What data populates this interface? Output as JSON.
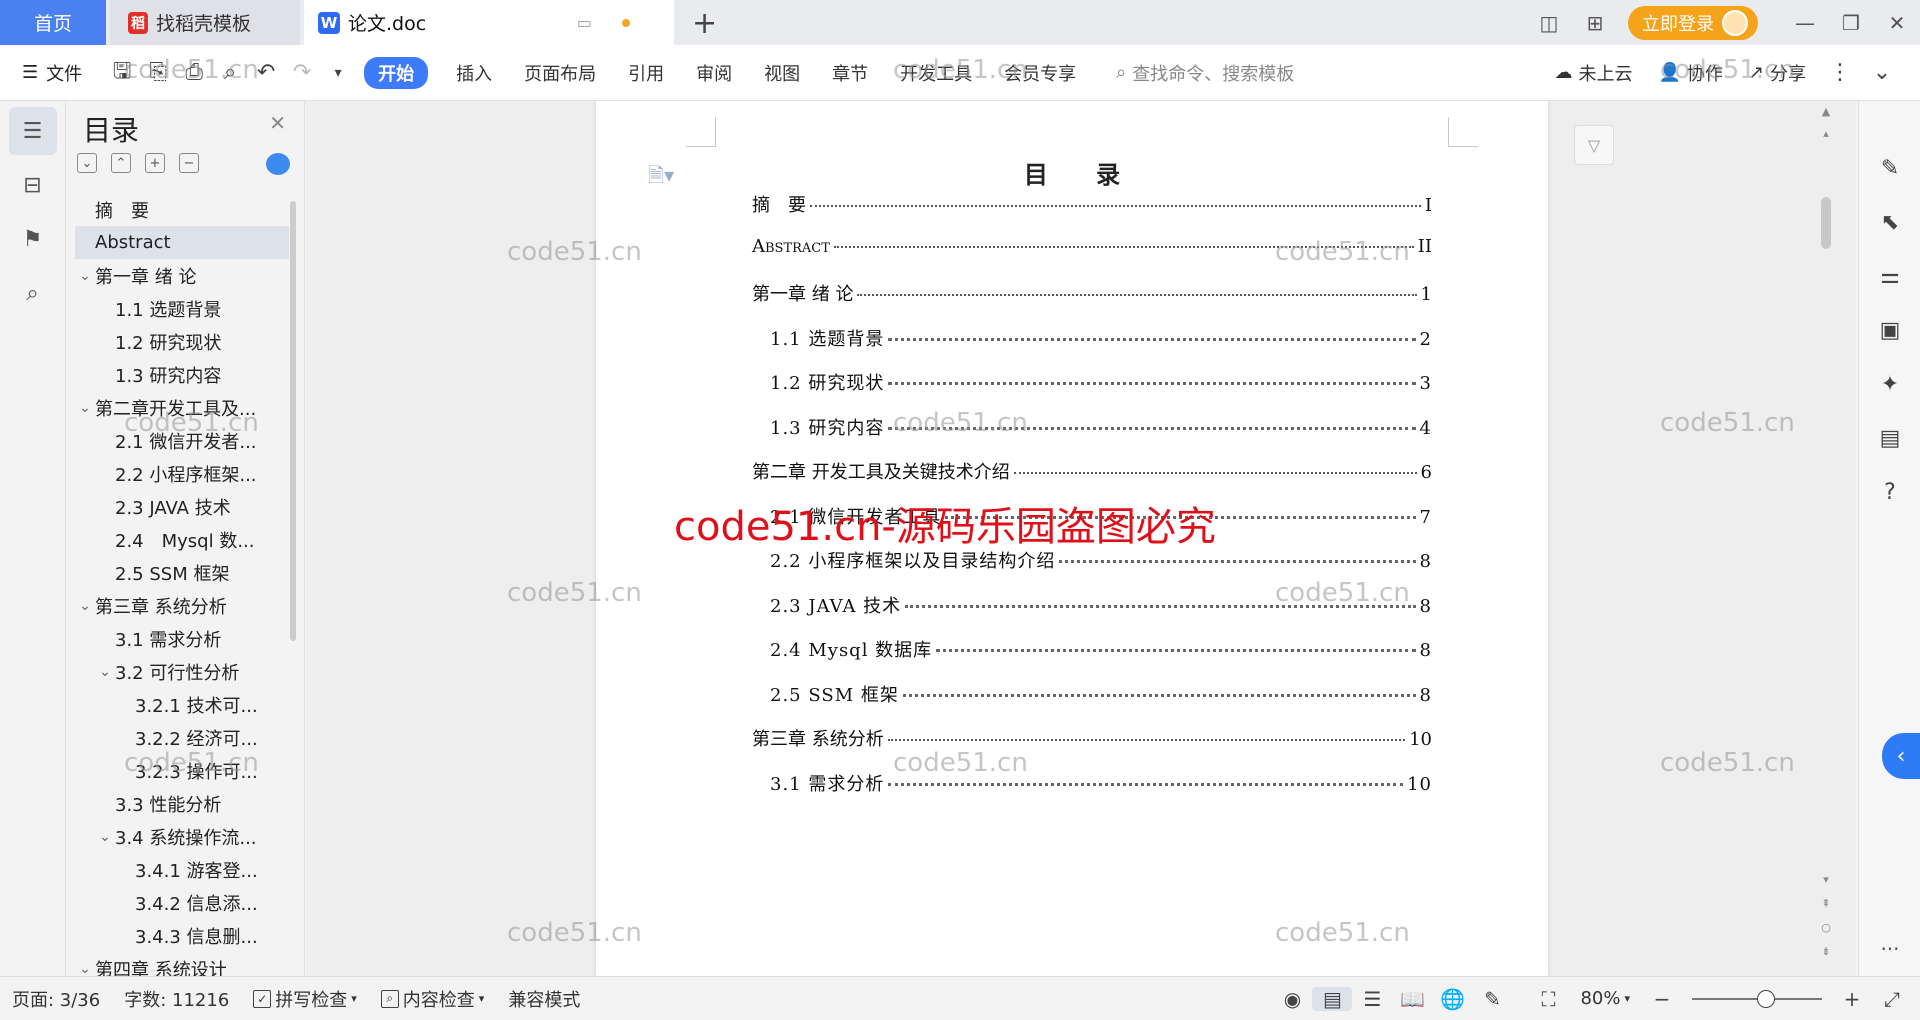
{
  "tabs": {
    "home": "首页",
    "template": "找稻壳模板",
    "document": "论文.doc",
    "new_tab": "+"
  },
  "titlebar": {
    "login": "立即登录"
  },
  "ribbon": {
    "file": "文件",
    "start": "开始",
    "menus": [
      "插入",
      "页面布局",
      "引用",
      "审阅",
      "视图",
      "章节",
      "开发工具",
      "会员专享"
    ],
    "search_placeholder": "查找命令、搜索模板",
    "cloud": "未上云",
    "collab": "协作",
    "share": "分享"
  },
  "toc_panel": {
    "title": "目录",
    "items": [
      {
        "label": "摘　要",
        "level": 0,
        "caret": "",
        "selected": false
      },
      {
        "label": "Abstract",
        "level": 0,
        "caret": "",
        "selected": true
      },
      {
        "label": "第一章 绪 论",
        "level": 0,
        "caret": "v",
        "selected": false
      },
      {
        "label": "1.1 选题背景",
        "level": 1,
        "caret": "",
        "selected": false
      },
      {
        "label": "1.2 研究现状",
        "level": 1,
        "caret": "",
        "selected": false
      },
      {
        "label": "1.3 研究内容",
        "level": 1,
        "caret": "",
        "selected": false
      },
      {
        "label": "第二章开发工具及...",
        "level": 0,
        "caret": "v",
        "selected": false
      },
      {
        "label": "2.1 微信开发者...",
        "level": 1,
        "caret": "",
        "selected": false
      },
      {
        "label": "2.2 小程序框架...",
        "level": 1,
        "caret": "",
        "selected": false
      },
      {
        "label": "2.3 JAVA 技术",
        "level": 1,
        "caret": "",
        "selected": false
      },
      {
        "label": "2.4　Mysql 数...",
        "level": 1,
        "caret": "",
        "selected": false
      },
      {
        "label": "2.5 SSM 框架",
        "level": 1,
        "caret": "",
        "selected": false
      },
      {
        "label": "第三章 系统分析",
        "level": 0,
        "caret": "v",
        "selected": false
      },
      {
        "label": "3.1 需求分析",
        "level": 1,
        "caret": "",
        "selected": false
      },
      {
        "label": "3.2 可行性分析",
        "level": 1,
        "caret": "v",
        "selected": false
      },
      {
        "label": "3.2.1 技术可...",
        "level": 2,
        "caret": "",
        "selected": false
      },
      {
        "label": "3.2.2 经济可...",
        "level": 2,
        "caret": "",
        "selected": false
      },
      {
        "label": "3.2.3 操作可...",
        "level": 2,
        "caret": "",
        "selected": false
      },
      {
        "label": "3.3 性能分析",
        "level": 1,
        "caret": "",
        "selected": false
      },
      {
        "label": "3.4 系统操作流...",
        "level": 1,
        "caret": "v",
        "selected": false
      },
      {
        "label": "3.4.1 游客登...",
        "level": 2,
        "caret": "",
        "selected": false
      },
      {
        "label": "3.4.2 信息添...",
        "level": 2,
        "caret": "",
        "selected": false
      },
      {
        "label": "3.4.3 信息删...",
        "level": 2,
        "caret": "",
        "selected": false
      },
      {
        "label": "第四章 系统设计",
        "level": 0,
        "caret": "v",
        "selected": false
      }
    ]
  },
  "document": {
    "title": "目 录",
    "entries": [
      {
        "label": "摘　要",
        "page": "I",
        "sub": false
      },
      {
        "label": "Abstract",
        "page": "II",
        "sub": false
      },
      {
        "label": "第一章 绪 论",
        "page": "1",
        "sub": false
      },
      {
        "label": "1.1 选题背景",
        "page": "2",
        "sub": true
      },
      {
        "label": "1.2 研究现状",
        "page": "3",
        "sub": true
      },
      {
        "label": "1.3 研究内容",
        "page": "4",
        "sub": true
      },
      {
        "label": "第二章 开发工具及关键技术介绍",
        "page": "6",
        "sub": false
      },
      {
        "label": "2.1 微信开发者工具",
        "page": "7",
        "sub": true
      },
      {
        "label": "2.2 小程序框架以及目录结构介绍",
        "page": "8",
        "sub": true
      },
      {
        "label": "2.3 JAVA 技术",
        "page": "8",
        "sub": true
      },
      {
        "label": "2.4 Mysql 数据库",
        "page": "8",
        "sub": true
      },
      {
        "label": "2.5 SSM 框架",
        "page": "8",
        "sub": true
      },
      {
        "label": "第三章 系统分析",
        "page": "10",
        "sub": false
      },
      {
        "label": "3.1 需求分析",
        "page": "10",
        "sub": true
      }
    ]
  },
  "watermark": {
    "text": "code51.cn",
    "red_text": "code51.cn-源码乐园盗图必究"
  },
  "statusbar": {
    "page": "页面: 3/36",
    "words": "字数: 11216",
    "spellcheck": "拼写检查",
    "content_check": "内容检查",
    "compat": "兼容模式",
    "zoom": "80%",
    "zoom_level": 0.57
  },
  "colors": {
    "accent": "#3e7bfa",
    "login": "#f5a31a",
    "red_watermark": "#e0101a"
  }
}
